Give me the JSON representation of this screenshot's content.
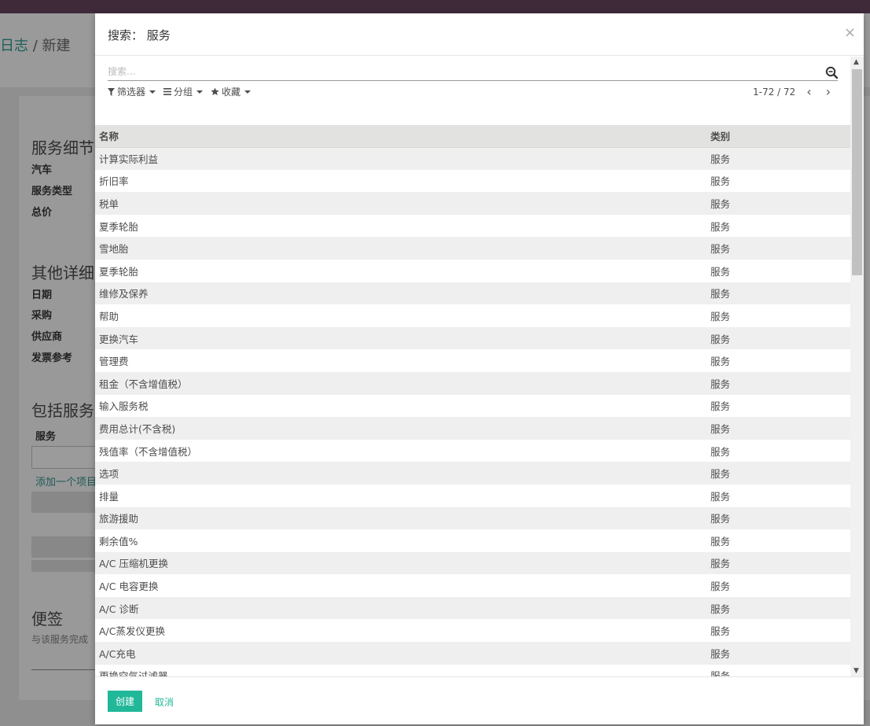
{
  "background": {
    "breadcrumb_parent": "日志",
    "breadcrumb_sep": "/",
    "breadcrumb_current": "新建",
    "section_service_details": "服务细节",
    "label_vehicle": "汽车",
    "label_service_type": "服务类型",
    "label_total_price": "总价",
    "section_other_details": "其他详细",
    "label_date": "日期",
    "label_purchaser": "采购",
    "label_vendor": "供应商",
    "label_invoice_ref": "发票参考",
    "section_included_services": "包括服务",
    "label_service": "服务",
    "add_item_link": "添加一个项目",
    "section_notes": "便签",
    "notes_placeholder": "与该服务完成"
  },
  "modal": {
    "title": "搜索： 服务",
    "close_symbol": "×",
    "search_placeholder": "搜索...",
    "filters_label": "筛选器",
    "group_by_label": "分组",
    "favorites_label": "收藏",
    "pager_value": "1-72 / 72",
    "columns": {
      "name": "名称",
      "category": "类别"
    },
    "rows": [
      {
        "name": "计算实际利益",
        "category": "服务"
      },
      {
        "name": "折旧率",
        "category": "服务"
      },
      {
        "name": "税单",
        "category": "服务"
      },
      {
        "name": "夏季轮胎",
        "category": "服务"
      },
      {
        "name": "雪地胎",
        "category": "服务"
      },
      {
        "name": "夏季轮胎",
        "category": "服务"
      },
      {
        "name": "维修及保养",
        "category": "服务"
      },
      {
        "name": "帮助",
        "category": "服务"
      },
      {
        "name": "更换汽车",
        "category": "服务"
      },
      {
        "name": "管理费",
        "category": "服务"
      },
      {
        "name": "租金（不含增值税）",
        "category": "服务"
      },
      {
        "name": "输入服务税",
        "category": "服务"
      },
      {
        "name": "费用总计(不含税)",
        "category": "服务"
      },
      {
        "name": "残值率（不含增值税）",
        "category": "服务"
      },
      {
        "name": "选项",
        "category": "服务"
      },
      {
        "name": "排量",
        "category": "服务"
      },
      {
        "name": "旅游援助",
        "category": "服务"
      },
      {
        "name": "剩余值%",
        "category": "服务"
      },
      {
        "name": "A/C 压缩机更换",
        "category": "服务"
      },
      {
        "name": "A/C 电容更换",
        "category": "服务"
      },
      {
        "name": "A/C 诊断",
        "category": "服务"
      },
      {
        "name": "A/C蒸发仪更换",
        "category": "服务"
      },
      {
        "name": "A/C充电",
        "category": "服务"
      },
      {
        "name": "更换空气过滤器",
        "category": "服务"
      }
    ],
    "create_label": "创建",
    "cancel_label": "取消"
  },
  "colors": {
    "primary": "#21b799",
    "topbar": "#3f2a3a",
    "header_row": "#e2e2e0",
    "odd_row": "#efefef"
  }
}
